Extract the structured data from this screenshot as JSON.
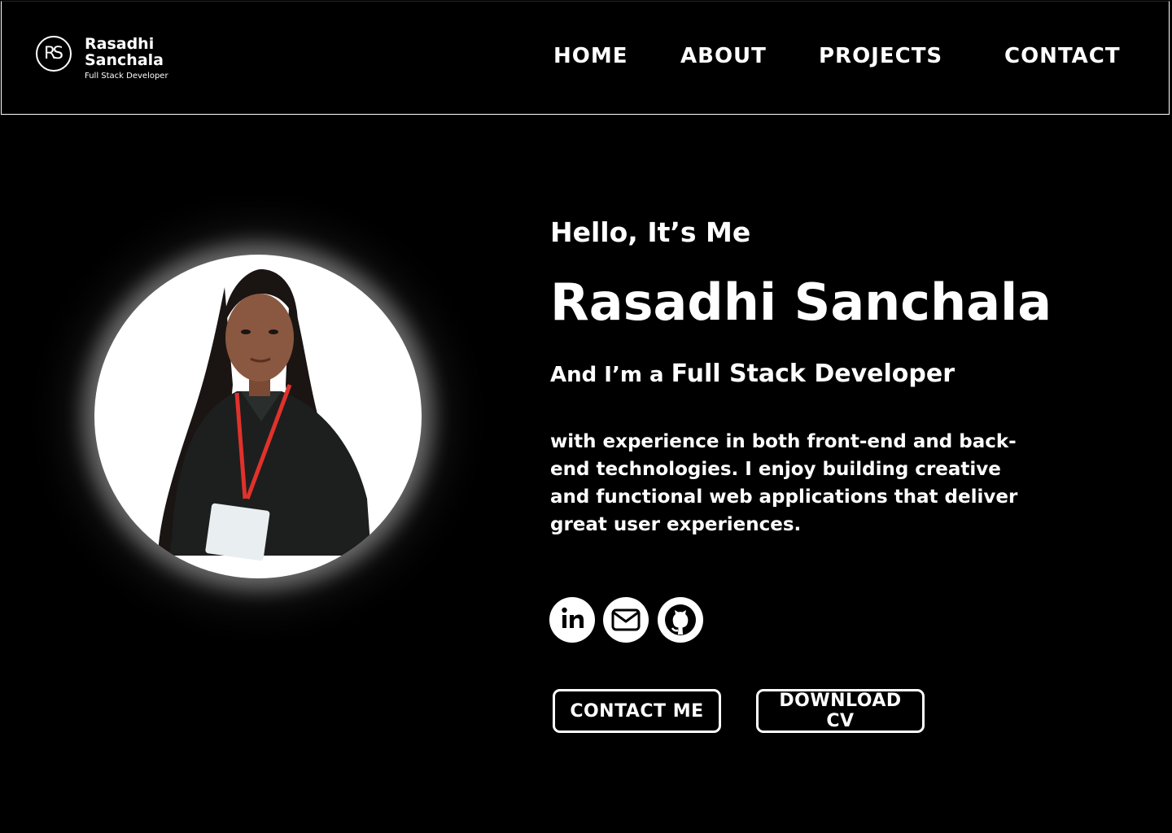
{
  "header": {
    "logo": {
      "monogram": "RS",
      "name_line1": "Rasadhi",
      "name_line2": "Sanchala",
      "subtitle": "Full Stack Developer"
    },
    "nav": [
      {
        "label": "HOME"
      },
      {
        "label": "ABOUT"
      },
      {
        "label": "PROJECTS"
      },
      {
        "label": "CONTACT"
      }
    ]
  },
  "hero": {
    "greeting": "Hello, It’s Me",
    "name": "Rasadhi Sanchala",
    "role_prefix": "And I’m a ",
    "role_title": "Full Stack Developer",
    "description": "with experience in both front-end and back-end technologies. I enjoy building creative and functional web applications that deliver great user experiences.",
    "social": [
      {
        "icon": "linkedin-icon"
      },
      {
        "icon": "mail-icon"
      },
      {
        "icon": "github-icon"
      }
    ],
    "buttons": {
      "contact": "CONTACT ME",
      "download": "DOWNLOAD CV"
    }
  },
  "colors": {
    "background": "#000000",
    "text": "#ffffff",
    "lanyard": "#e0322b",
    "shirt": "#1c1f1e"
  }
}
